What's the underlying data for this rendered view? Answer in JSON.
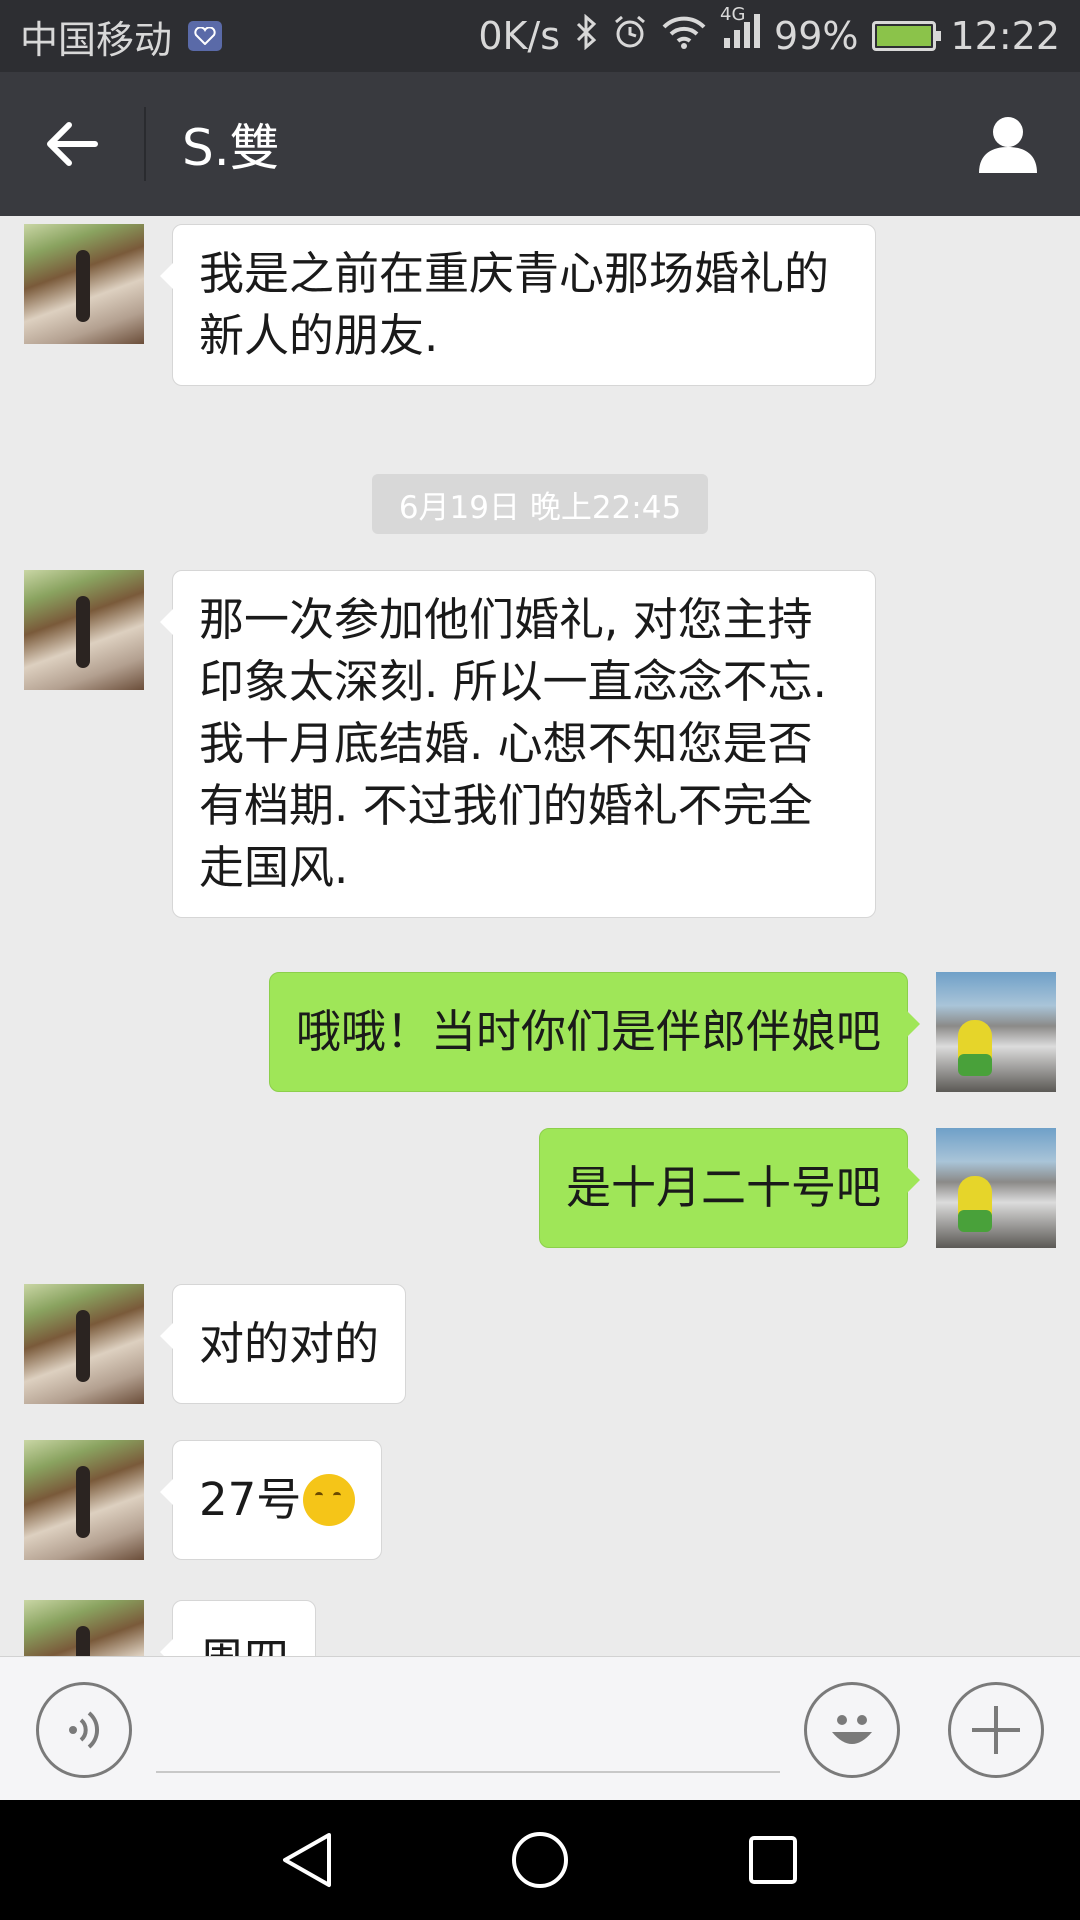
{
  "status_bar": {
    "carrier": "中国移动",
    "speed": "0K/s",
    "network": "4G",
    "battery": "99%",
    "battery_level": 0.99,
    "time": "12:22"
  },
  "header": {
    "title": "S.雙",
    "back_icon": "arrow-left-icon",
    "profile_icon": "person-icon"
  },
  "chat": {
    "timestamp": "6月19日 晚上22:45",
    "messages": [
      {
        "from": "friend",
        "text": "我是之前在重庆青心那场婚礼的新人的朋友."
      },
      {
        "from": "friend",
        "text": "那一次参加他们婚礼, 对您主持印象太深刻. 所以一直念念不忘. 我十月底结婚. 心想不知您是否有档期. 不过我们的婚礼不完全走国风."
      },
      {
        "from": "self",
        "text": "哦哦！当时你们是伴郎伴娘吧"
      },
      {
        "from": "self",
        "text": "是十月二十号吧"
      },
      {
        "from": "friend",
        "text": "对的对的"
      },
      {
        "from": "friend",
        "text": "27号",
        "emoji": "thinking-face-icon"
      },
      {
        "from": "friend",
        "text": "周四"
      }
    ]
  },
  "input_bar": {
    "voice_icon": "voice-icon",
    "emoji_icon": "smiley-icon",
    "more_icon": "plus-icon",
    "input_value": ""
  },
  "nav_bar": {
    "back_icon": "triangle-back-icon",
    "home_icon": "circle-home-icon",
    "recents_icon": "square-recents-icon"
  },
  "colors": {
    "status_bar_bg": "#2d2e32",
    "title_bar_bg": "#393a3f",
    "chat_bg": "#ebebeb",
    "incoming_bubble": "#ffffff",
    "outgoing_bubble": "#9fe658"
  }
}
